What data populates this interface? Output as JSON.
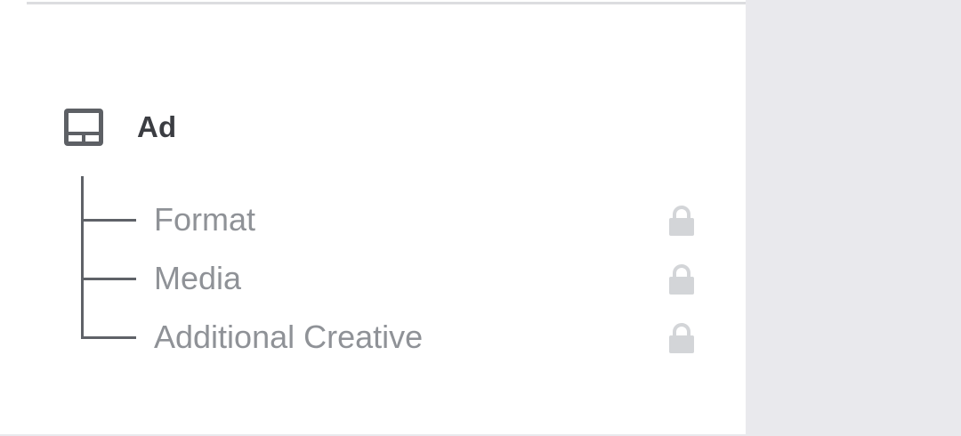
{
  "section": {
    "title": "Ad",
    "icon": "ad-layout-icon"
  },
  "tree_items": [
    {
      "label": "Format",
      "status_icon": "lock-icon"
    },
    {
      "label": "Media",
      "status_icon": "lock-icon"
    },
    {
      "label": "Additional Creative",
      "status_icon": "lock-icon"
    }
  ],
  "colors": {
    "background": "#ffffff",
    "sidebar": "#e9e9ed",
    "title": "#3b3d42",
    "item_text": "#8f9297",
    "tree_line": "#5f6268",
    "lock": "#d3d5d8"
  }
}
